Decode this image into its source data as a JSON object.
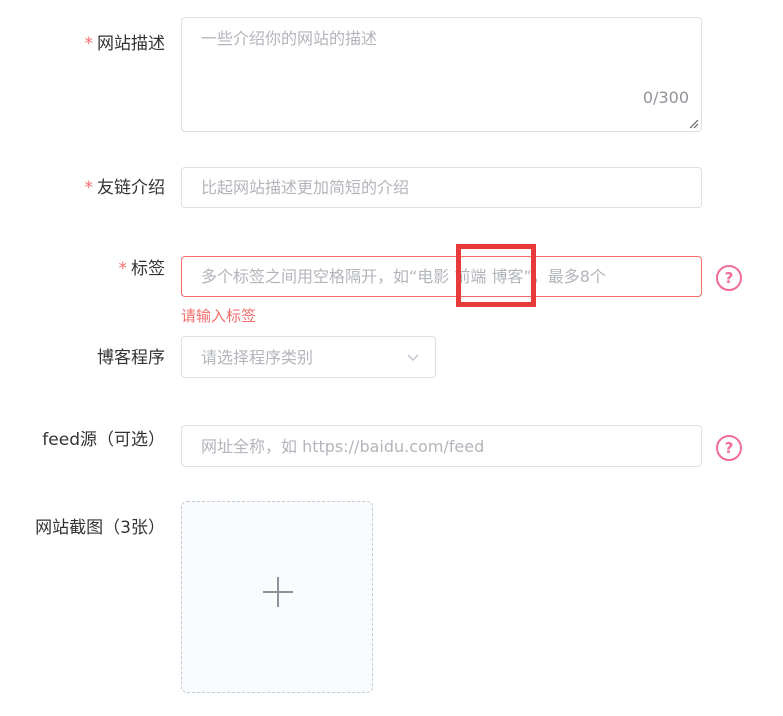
{
  "form": {
    "description": {
      "required_mark": "*",
      "label": "网站描述",
      "placeholder": "一些介绍你的网站的描述",
      "counter": "0/300"
    },
    "friend_intro": {
      "required_mark": "*",
      "label": "友链介绍",
      "placeholder": "比起网站描述更加简短的介绍"
    },
    "tags": {
      "required_mark": "*",
      "label": "标签",
      "placeholder": "多个标签之间用空格隔开，如“电影 前端 博客”，最多8个",
      "error": "请输入标签"
    },
    "blog_program": {
      "label": "博客程序",
      "placeholder": "请选择程序类别"
    },
    "feed": {
      "label": "feed源（可选）",
      "placeholder": "网址全称，如 https://baidu.com/feed"
    },
    "screenshots": {
      "label": "网站截图（3张）"
    }
  },
  "icons": {
    "help": "?",
    "help_color": "#f06d94",
    "error_color": "#f56c6c",
    "highlight_color": "#e83a3a"
  }
}
